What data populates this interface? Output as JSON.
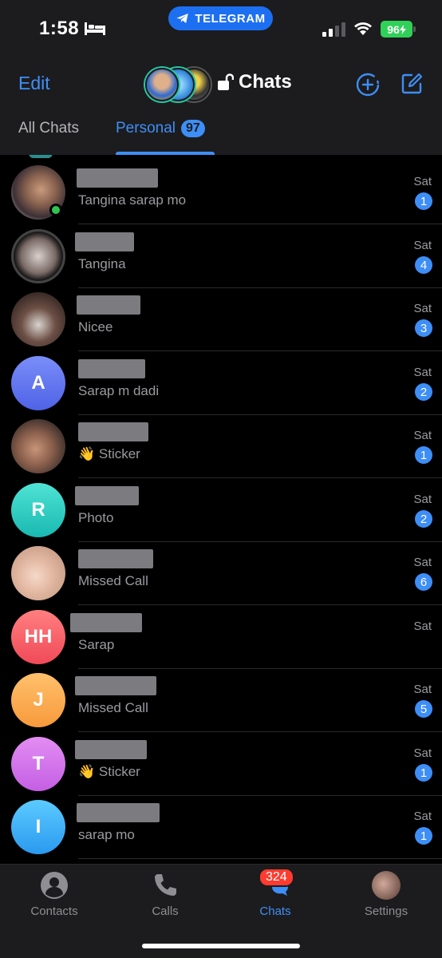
{
  "status_bar": {
    "time": "1:58",
    "pill_label": "TELEGRAM",
    "battery": "96"
  },
  "header": {
    "edit_label": "Edit",
    "title": "Chats"
  },
  "tabs": [
    {
      "label": "All Chats"
    },
    {
      "label": "Personal",
      "badge": "97"
    }
  ],
  "chats": [
    {
      "preview": "Tangina sarap mo",
      "date": "Sat",
      "count": "1"
    },
    {
      "preview": "Tangina",
      "date": "Sat",
      "count": "4"
    },
    {
      "preview": "Nicee",
      "date": "Sat",
      "count": "3"
    },
    {
      "initials": "A",
      "preview": "Sarap m dadi",
      "date": "Sat",
      "count": "2"
    },
    {
      "preview": "👋 Sticker",
      "date": "Sat",
      "count": "1"
    },
    {
      "initials": "R",
      "preview": "Photo",
      "date": "Sat",
      "count": "2"
    },
    {
      "preview": "Missed Call",
      "date": "Sat",
      "count": "6"
    },
    {
      "initials": "HH",
      "preview": "Sarap",
      "date": "Sat",
      "count": ""
    },
    {
      "initials": "J",
      "preview": "Missed Call",
      "date": "Sat",
      "count": "5"
    },
    {
      "initials": "T",
      "preview": "👋 Sticker",
      "date": "Sat",
      "count": "1"
    },
    {
      "initials": "I",
      "preview": "sarap mo",
      "date": "Sat",
      "count": "1"
    }
  ],
  "tabbar": {
    "contacts": "Contacts",
    "calls": "Calls",
    "chats": "Chats",
    "chats_badge": "324",
    "settings": "Settings"
  },
  "colors": {
    "accent": "#3e8ef7",
    "online": "#31c350",
    "badge_red": "#ff3b30"
  }
}
